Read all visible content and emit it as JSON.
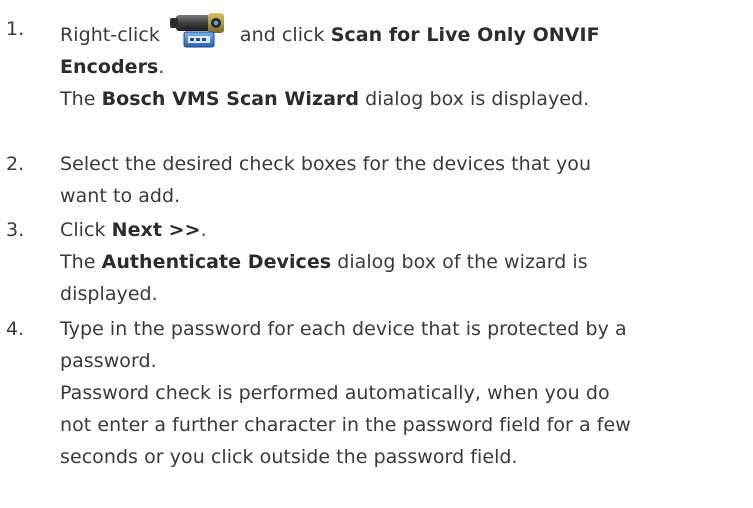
{
  "steps": [
    {
      "number": "1.",
      "line1_pre": "Right-click",
      "icon": "camera-encoder-icon",
      "line1_mid": "and click",
      "line1_bold": "Scan for Live Only ONVIF",
      "line2_bold": "Encoders",
      "line2_post": ".",
      "line3_pre": "The",
      "line3_bold": "Bosch VMS Scan Wizard",
      "line3_post": "dialog box is displayed."
    },
    {
      "number": "2.",
      "line1": "Select the desired check boxes for the devices that you",
      "line2": "want to add."
    },
    {
      "number": "3.",
      "line1_pre": "Click",
      "line1_bold": "Next >>",
      "line1_post": ".",
      "line2_pre": "The",
      "line2_bold": "Authenticate Devices",
      "line2_post": "dialog box of the wizard is",
      "line3": "displayed."
    },
    {
      "number": "4.",
      "line1": "Type in the password for each device that is protected by a",
      "line2": "password.",
      "line3": "Password check is performed automatically, when you do",
      "line4": "not enter a further character in the password field for a few",
      "line5": "seconds or you click outside the password field."
    }
  ]
}
